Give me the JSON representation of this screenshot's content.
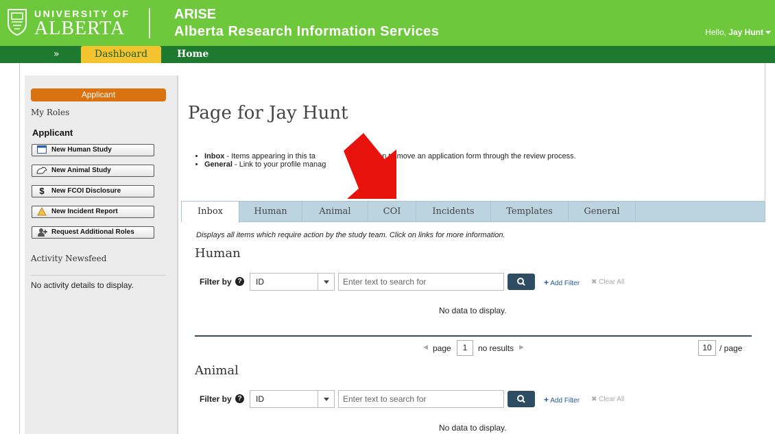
{
  "header": {
    "university_line1": "UNIVERSITY OF",
    "university_line2": "ALBERTA",
    "app_short": "ARISE",
    "app_full": "Alberta Research Information Services",
    "greeting_prefix": "Hello, ",
    "user_name": "Jay Hunt"
  },
  "nav": {
    "expand_glyph": "»",
    "dashboard_tab": "Dashboard",
    "home_link": "Home"
  },
  "sidebar": {
    "current_role_pill": "Applicant",
    "my_roles_label": "My Roles",
    "role_name": "Applicant",
    "buttons": [
      {
        "label": "New Human Study",
        "icon": "window-icon"
      },
      {
        "label": "New Animal Study",
        "icon": "animal-icon"
      },
      {
        "label": "New FCOI Disclosure",
        "icon": "dollar-icon"
      },
      {
        "label": "New Incident Report",
        "icon": "alert-icon"
      },
      {
        "label": "Request Additional Roles",
        "icon": "person-add-icon"
      }
    ],
    "activity_title": "Activity Newsfeed",
    "activity_empty": "No activity details to display."
  },
  "main": {
    "page_title": "Page for Jay Hunt",
    "bullets": [
      {
        "term": "Inbox",
        "text": " - Items appearing in this ta",
        "text_tail": "our action to move an application form through the review process."
      },
      {
        "term": "General",
        "text": " - Link to your profile manag",
        "text_tail": ""
      }
    ],
    "tabs": [
      "Inbox",
      "Human",
      "Animal",
      "COI",
      "Incidents",
      "Templates",
      "General"
    ],
    "active_tab": "Inbox",
    "tab_description": "Displays all items which require action by the study team. Click on links for more information.",
    "sections": [
      {
        "title": "Human",
        "filter_label": "Filter by",
        "filter_field": "ID",
        "search_placeholder": "Enter text to search for",
        "add_filter": "Add Filter",
        "clear_all": "Clear All",
        "empty_text": "No data to display."
      },
      {
        "title": "Animal",
        "filter_label": "Filter by",
        "filter_field": "ID",
        "search_placeholder": "Enter text to search for",
        "add_filter": "Add Filter",
        "clear_all": "Clear All",
        "empty_text": "No data to display."
      }
    ],
    "pager": {
      "page_label": "page",
      "page_number": "1",
      "results_text": "no results",
      "per_page_value": "10",
      "per_page_label": "/ page"
    }
  },
  "annotation": {
    "arrow_color": "#e8120c",
    "points_to": "COI"
  },
  "colors": {
    "header_green": "#6dc93b",
    "nav_green": "#1e7a2e",
    "dashboard_gold": "#f4c430",
    "applicant_orange": "#d9720f",
    "tab_bar_blue": "#bcd4e0",
    "search_button": "#2e4d63"
  }
}
